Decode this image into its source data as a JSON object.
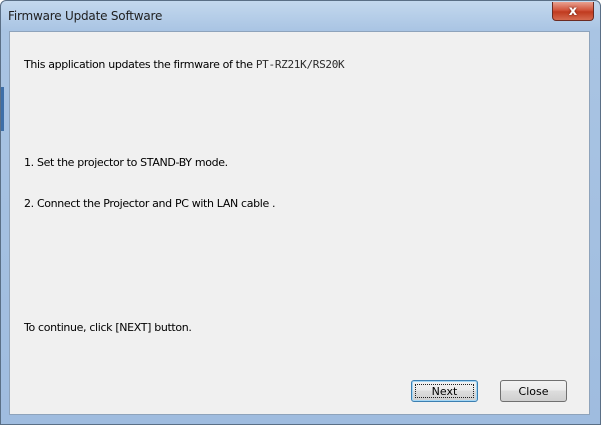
{
  "window": {
    "title": "Firmware Update Software",
    "close_glyph": "x"
  },
  "content": {
    "intro_prefix": "This application updates the firmware of the",
    "model": "PT-RZ21K/RS20K",
    "step1": "1. Set the projector to STAND-BY mode.",
    "step2": "2. Connect the Projector and PC with LAN cable .",
    "continue_text": "To continue, click [NEXT] button."
  },
  "buttons": {
    "next_label": "Next",
    "close_label": "Close"
  },
  "icons": {
    "close": "close-icon"
  },
  "colors": {
    "title_bar": "#a9c4e3",
    "close_button": "#c8452b",
    "client_background": "#f0f0f0"
  }
}
